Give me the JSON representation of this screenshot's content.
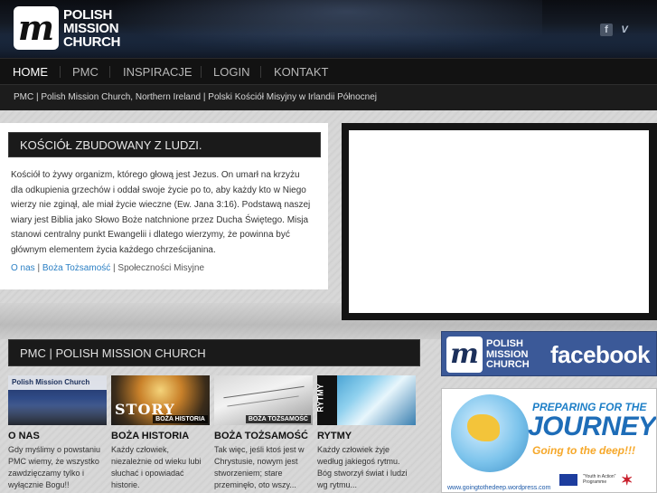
{
  "header": {
    "logo_line1": "POLISH",
    "logo_line2": "MISSION",
    "logo_line3": "CHURCH",
    "logo_mark": "m",
    "social": [
      {
        "icon": "facebook-icon",
        "glyph": "f"
      },
      {
        "icon": "vimeo-icon",
        "glyph": "V"
      }
    ]
  },
  "nav": {
    "items": [
      "HOME",
      "PMC",
      "INSPIRACJE",
      "LOGIN",
      "KONTAKT"
    ],
    "active": "HOME"
  },
  "breadcrumb": "PMC | Polish Mission Church, Northern Ireland | Polski Kościół Misyjny w Irlandii Północnej",
  "main": {
    "title": "KOŚCIÓŁ ZBUDOWANY Z LUDZI.",
    "body": "Kościół to żywy organizm, którego głową jest Jezus. On umarł na krzyżu dla odkupienia grzechów i oddał swoje życie po to, aby każdy kto w Niego wierzy nie zginął, ale miał życie wieczne (Ew. Jana 3:16). Podstawą naszej wiary jest Biblia jako Słowo Boże natchnione przez Ducha Świętego. Misja stanowi centralny punkt Ewangelii i dlatego wierzymy, że powinna być głównym elementem życia każdego chrześcijanina.",
    "link1": "O nas",
    "link2": "Boża Tożsamość",
    "sep": " | ",
    "link3": "Społeczności Misyjne"
  },
  "section": {
    "title": "PMC | POLISH MISSION CHURCH",
    "cards": [
      {
        "title": "O NAS",
        "thumb_caption": "Polish Mission Church",
        "text": "Gdy myślimy o powstaniu PMC wiemy, że wszystko zawdzięczamy tylko i wyłącznie Bogu!!"
      },
      {
        "title": "BOŻA HISTORIA",
        "thumb_caption": "BOŻA HISTORIA",
        "thumb_word": "STORY",
        "text": "Każdy człowiek, niezależnie od wieku lubi słuchać i opowiadać historie."
      },
      {
        "title": "BOŻA TOŻSAMOŚĆ",
        "thumb_caption": "BOŻA TOŻSAMOŚĆ",
        "text": "Tak więc, jeśli ktoś jest w Chrystusie, nowym jest stworzeniem; stare przeminęło, oto wszy..."
      },
      {
        "title": "RYTMY",
        "thumb_caption": "RYTMY",
        "text": "Każdy człowiek żyje według jakiegoś rytmu. Bóg stworzył świat i ludzi wg rytmu..."
      }
    ]
  },
  "sidebar": {
    "fb_line1": "POLISH",
    "fb_line2": "MISSION",
    "fb_line3": "CHURCH",
    "fb_word": "facebook",
    "journey_top": "PREPARING FOR THE",
    "journey_main": "JOURNEY",
    "journey_sub": "Going to the deep!!!",
    "journey_url": "www.goingtothedeep.wordpress.com",
    "journey_badge": "\"Youth in Action\" Programme"
  },
  "colors": {
    "accent_link": "#2a7fc4",
    "facebook": "#3b5998",
    "nav_bg": "#121212"
  }
}
